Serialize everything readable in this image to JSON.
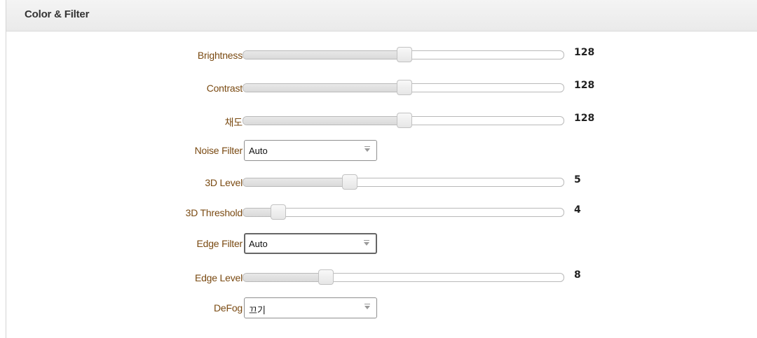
{
  "panel": {
    "title": "Color & Filter"
  },
  "settings": [
    {
      "id": "brightness",
      "type": "slider",
      "label": "Brightness",
      "value": "128",
      "level": 0.503
    },
    {
      "id": "contrast",
      "type": "slider",
      "label": "Contrast",
      "value": "128",
      "level": 0.503
    },
    {
      "id": "saturation",
      "type": "slider",
      "label": "채도",
      "value": "128",
      "level": 0.503
    },
    {
      "id": "noise-filter",
      "type": "select",
      "label": "Noise Filter",
      "selected": "Auto"
    },
    {
      "id": "3d-level",
      "type": "slider",
      "label": "3D Level",
      "value": "5",
      "level": 0.332
    },
    {
      "id": "3d-threshold",
      "type": "slider",
      "label": "3D Threshold",
      "value": "4",
      "level": 0.109
    },
    {
      "id": "edge-filter",
      "type": "select",
      "label": "Edge Filter",
      "selected": "Auto"
    },
    {
      "id": "edge-level",
      "type": "slider",
      "label": "Edge Level",
      "value": "8",
      "level": 0.258
    },
    {
      "id": "defog",
      "type": "select",
      "label": "DeFog",
      "selected": "끄기"
    }
  ]
}
